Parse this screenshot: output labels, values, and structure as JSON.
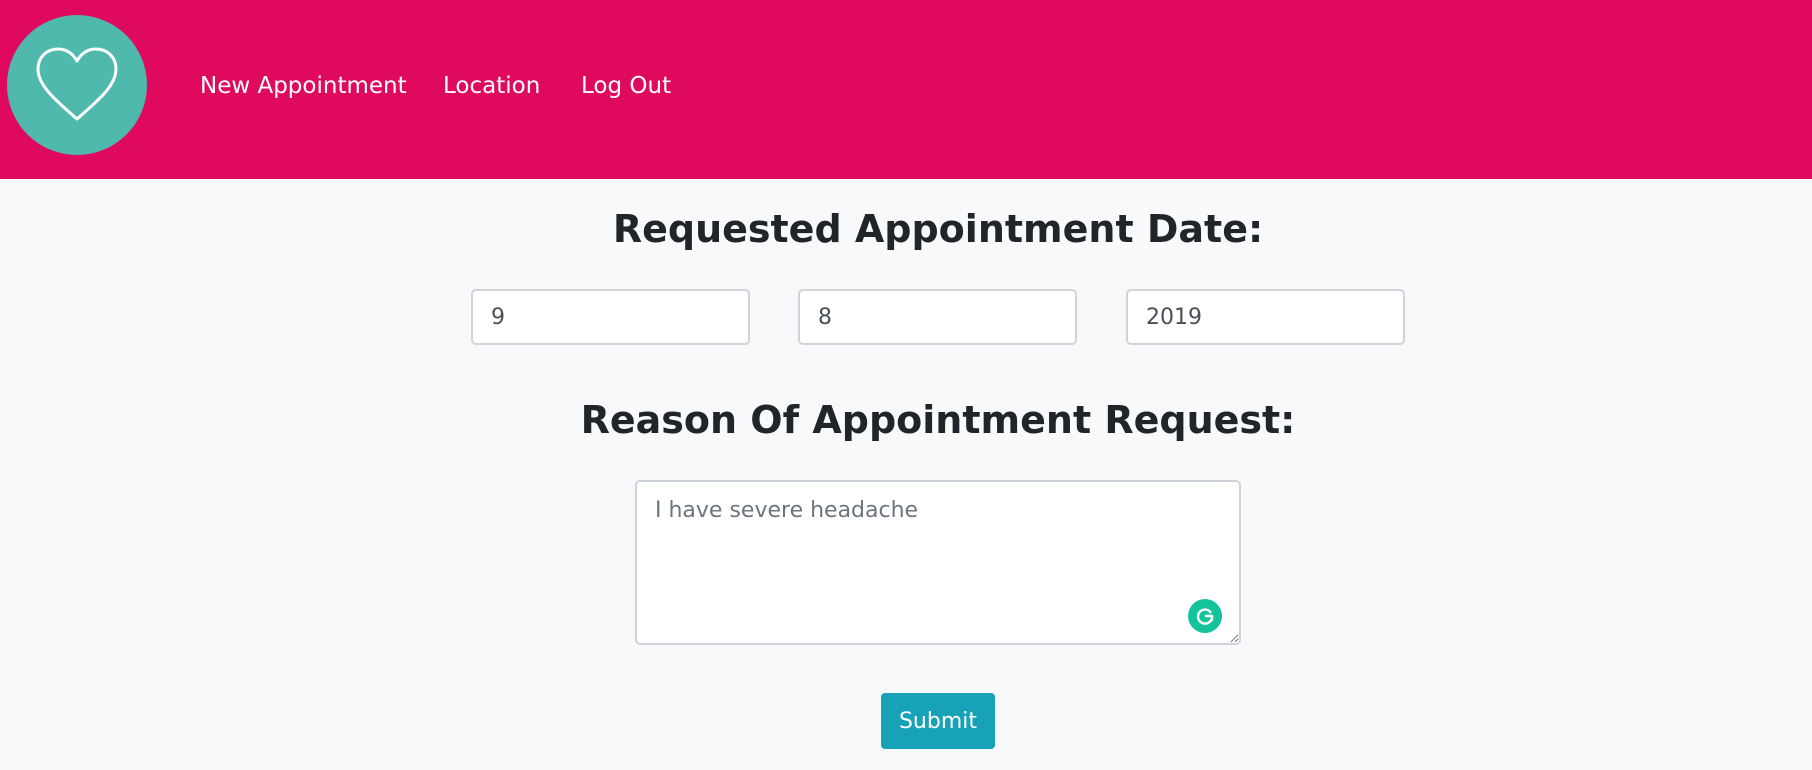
{
  "nav": {
    "logo_icon": "heart-icon",
    "links": [
      "New Appointment",
      "Location",
      "Log Out"
    ]
  },
  "form": {
    "date_heading": "Requested Appointment Date:",
    "day": "9",
    "month": "8",
    "year": "2019",
    "reason_heading": "Reason Of Appointment Request:",
    "reason_text": "I have severe headache",
    "grammarly_icon": "grammarly-g-icon",
    "submit_label": "Submit"
  },
  "colors": {
    "navbar": "#df0a5e",
    "logo_bg": "#4fb9ae",
    "submit_bg": "#17a2b8",
    "grammarly": "#15c39a",
    "page_bg": "#f8f9fa"
  }
}
